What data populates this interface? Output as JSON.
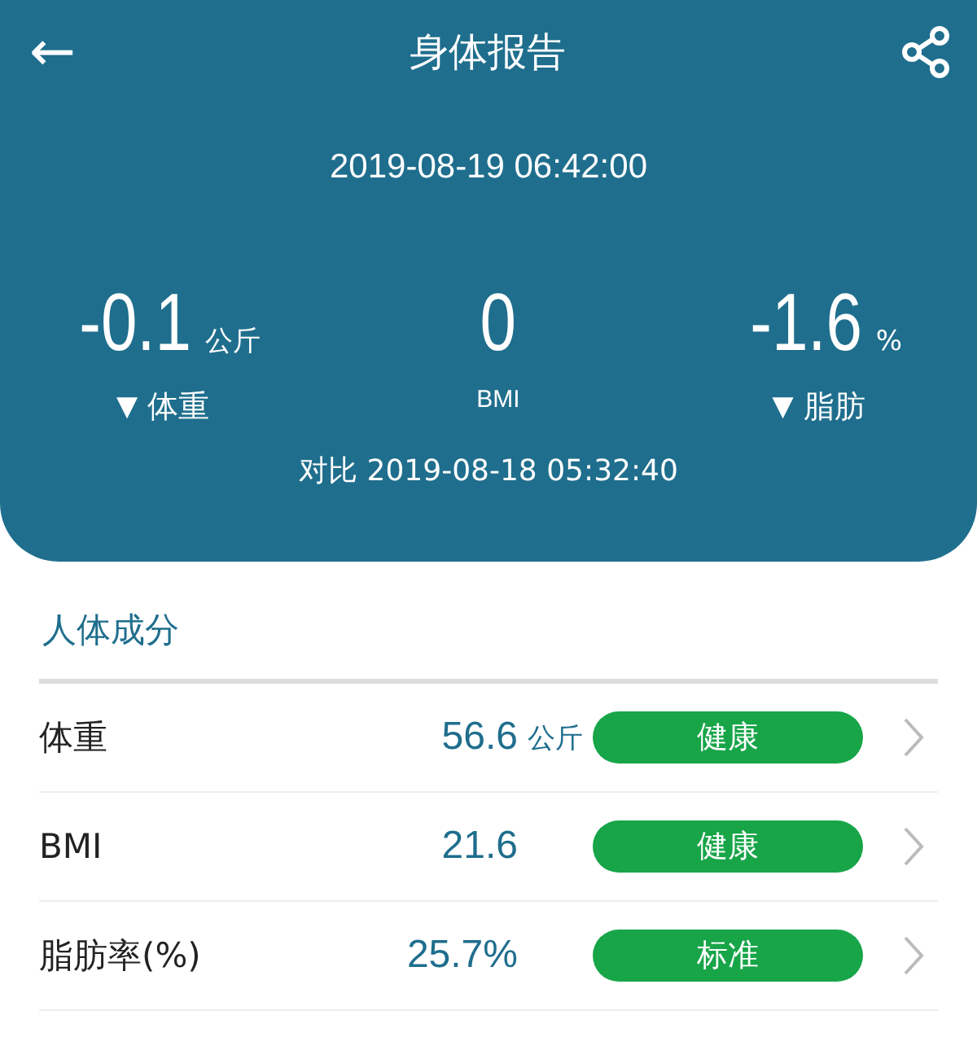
{
  "header": {
    "back": "←",
    "title": "身体报告",
    "datetime": "2019-08-19 06:42:00",
    "stats": [
      {
        "value": "-0.1",
        "unit": "公斤",
        "arrow": "▼",
        "label": "体重"
      },
      {
        "value": "0",
        "label": "BMI"
      },
      {
        "value": "-1.6",
        "unit": "%",
        "arrow": "▼",
        "label": "脂肪"
      }
    ],
    "compare": "对比 2019-08-18 05:32:40"
  },
  "section": {
    "title": "人体成分",
    "rows": [
      {
        "name": "体重",
        "value": "56.6",
        "unit": "公斤",
        "status": "健康",
        "color": "#17a548"
      },
      {
        "name": "BMI",
        "value": "21.6",
        "status": "健康",
        "color": "#17a548"
      },
      {
        "name": "脂肪率(%)",
        "value": "25.7%",
        "status": "标准",
        "color": "#17a548"
      }
    ]
  }
}
